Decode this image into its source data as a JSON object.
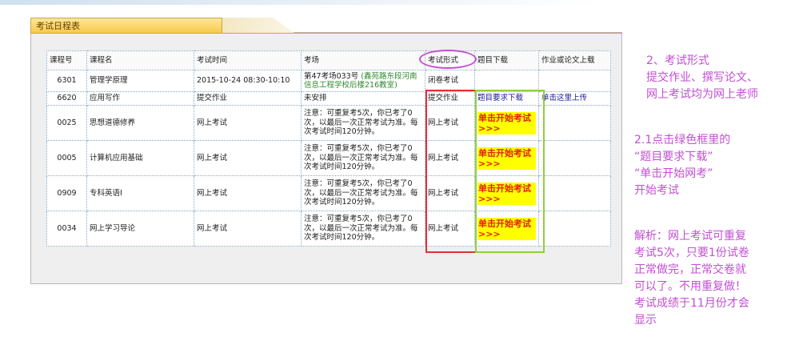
{
  "tab_title": "考试日程表",
  "headers": [
    "课程号",
    "课程名",
    "考试时间",
    "考场",
    "考试形式",
    "题目下载",
    "作业或论文上载"
  ],
  "rows": [
    {
      "code": "6301",
      "name": "管理学原理",
      "time": "2015-10-24 08:30-10:10",
      "room_prefix": "第47考场033号",
      "room_highlight": "(鑫苑路东段河南信息工程学校后楼216教室)",
      "form": "闭卷考试",
      "download": "",
      "upload": ""
    },
    {
      "code": "6620",
      "name": "应用写作",
      "time": "提交作业",
      "room": "未安排",
      "form": "提交作业",
      "download": "题目要求下载",
      "upload": "单击这里上传"
    },
    {
      "code": "0025",
      "name": "思想道德修养",
      "time": "网上考试",
      "room": "注意：可重复考5次，你已考了0次，以最后一次正常考试为准。每次考试时间120分钟。",
      "form": "网上考试",
      "start": "单击开始考试>>>",
      "upload": ""
    },
    {
      "code": "0005",
      "name": "计算机应用基础",
      "time": "网上考试",
      "room": "注意：可重复考5次，你已考了0次，以最后一次正常考试为准。每次考试时间120分钟。",
      "form": "网上考试",
      "start": "单击开始考试>>>",
      "upload": ""
    },
    {
      "code": "0909",
      "name": "专科英语I",
      "time": "网上考试",
      "room": "注意：可重复考5次，你已考了0次，以最后一次正常考试为准。每次考试时间120分钟。",
      "form": "网上考试",
      "start": "单击开始考试>>>",
      "upload": ""
    },
    {
      "code": "0034",
      "name": "网上学习导论",
      "time": "网上考试",
      "room": "注意：可重复考5次，你已考了0次，以最后一次正常考试为准。每次考试时间120分钟。",
      "form": "网上考试",
      "start": "单击开始考试>>>",
      "upload": ""
    }
  ],
  "notes": {
    "n1": [
      "2、考试形式",
      "提交作业、撰写论文、",
      "网上考试均为网上老师"
    ],
    "n2": [
      "2.1点击绿色框里的",
      "“题目要求下载”",
      "“单击开始网考”",
      "开始考试"
    ],
    "n3": [
      "解析：网上考试可重复",
      "考试5次，只要1份试卷",
      "正常做完，正常交卷就",
      "可以了。不用重复做！",
      "考试成绩于11月份才会",
      "显示"
    ]
  },
  "colors": {
    "annotation": "#c24fd2",
    "red_box": "#e0303d",
    "green_box": "#8fd13a",
    "start_bg": "#ffff00",
    "start_text": "#e02000"
  }
}
